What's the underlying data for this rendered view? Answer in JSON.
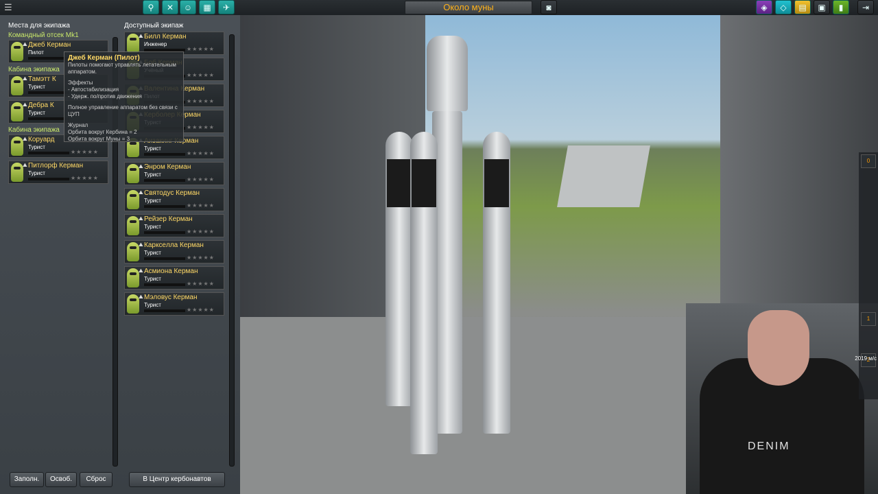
{
  "location": "Около муны",
  "crew_panel": {
    "left_header": "Места для экипажа",
    "right_header": "Доступный экипаж",
    "sections": [
      {
        "label": "Командный отсек Mk1",
        "kerbals": [
          {
            "name": "Джеб Керман",
            "role": "Пилот"
          }
        ]
      },
      {
        "label": "Кабина экипажа",
        "kerbals": [
          {
            "name": "Тамэтт К",
            "role": "Турист"
          },
          {
            "name": "Дебра К",
            "role": "Турист"
          }
        ]
      },
      {
        "label": "Кабина экипажа",
        "kerbals": [
          {
            "name": "Коруард",
            "role": "Турист"
          },
          {
            "name": "Питлорф Керман",
            "role": "Турист"
          }
        ]
      }
    ],
    "available": [
      {
        "name": "Билл Керман",
        "role": "Инженер"
      },
      {
        "name": "Боб Керман",
        "role": "Учёный"
      },
      {
        "name": "Валентина Керман",
        "role": "Пилот"
      },
      {
        "name": "Керболер Керман",
        "role": "Турист"
      },
      {
        "name": "Аизакинг Керман",
        "role": "Турист"
      },
      {
        "name": "Энром Керман",
        "role": "Турист"
      },
      {
        "name": "Святодус Керман",
        "role": "Турист"
      },
      {
        "name": "Рейзер Керман",
        "role": "Турист"
      },
      {
        "name": "Карксeлла Керман",
        "role": "Турист"
      },
      {
        "name": "Асмиона Керман",
        "role": "Турист"
      },
      {
        "name": "Мэловус Керман",
        "role": "Турист"
      }
    ],
    "buttons": {
      "fill": "Заполн.",
      "clear": "Освоб.",
      "reset": "Сброс",
      "astronaut_center": "В Центр кербонавтов"
    },
    "tooltip": {
      "title": "Джеб Керман (Пилот)",
      "desc": "Пилоты помогают управлять летательным аппаратом.",
      "effects_header": "Эффекты",
      "effect1": "- Автостабилизация",
      "effect2": "- Удерж. по/против движения",
      "full_control": "Полное управление аппаратом без связи с ЦУП",
      "journal": "Журнал",
      "orbit_kerbin": "Орбита вокруг Кербина = 2",
      "orbit_mun": "Орбита вокруг Муны = 3"
    }
  },
  "hud": {
    "stage0": "0",
    "stage1": "1",
    "stage2": "2",
    "speed": "2019 м/с"
  },
  "webcam": {
    "brand": "DENIM"
  },
  "stars": "★★★★★",
  "colors": {
    "accent_orange": "#ffb21a",
    "name_yellow": "#ffd966",
    "section_green": "#c9e86a"
  }
}
